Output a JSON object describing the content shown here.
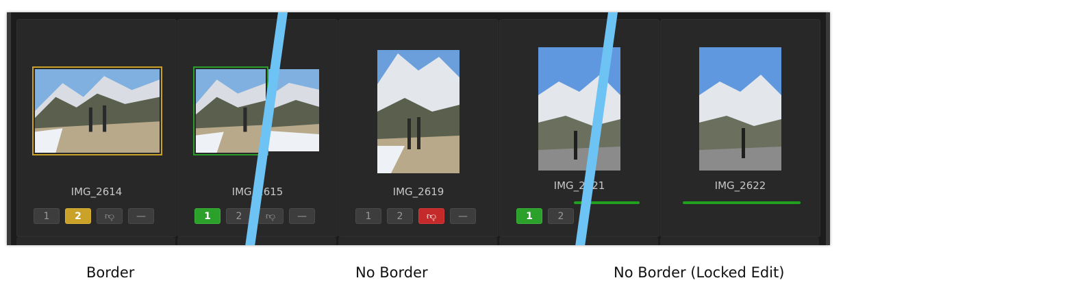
{
  "cards": [
    {
      "filename": "IMG_2614",
      "buttons": [
        {
          "label": "1",
          "state": "normal"
        },
        {
          "label": "2",
          "state": "yellow"
        },
        {
          "icon": "thumbs-down-icon",
          "state": "normal"
        },
        {
          "label": "—",
          "state": "normal"
        }
      ]
    },
    {
      "filename": "IMG_2615",
      "buttons": [
        {
          "label": "1",
          "state": "green"
        },
        {
          "label": "2",
          "state": "normal"
        },
        {
          "icon": "thumbs-down-icon",
          "state": "normal"
        },
        {
          "label": "—",
          "state": "normal"
        }
      ]
    },
    {
      "filename": "IMG_2619",
      "buttons": [
        {
          "label": "1",
          "state": "normal"
        },
        {
          "label": "2",
          "state": "normal"
        },
        {
          "icon": "thumbs-down-icon",
          "state": "red"
        },
        {
          "label": "—",
          "state": "normal"
        }
      ]
    },
    {
      "filename": "IMG_2621",
      "buttons": [
        {
          "label": "1",
          "state": "green"
        },
        {
          "label": "2",
          "state": "normal"
        }
      ]
    },
    {
      "filename": "IMG_2622",
      "buttons": []
    }
  ],
  "captions": {
    "border": "Border",
    "no_border": "No Border",
    "no_border_locked": "No Border (Locked Edit)"
  },
  "colors": {
    "yellow": "#c9a227",
    "green": "#2ba02b",
    "red": "#c42a2a",
    "divider": "#6ec3f5"
  }
}
